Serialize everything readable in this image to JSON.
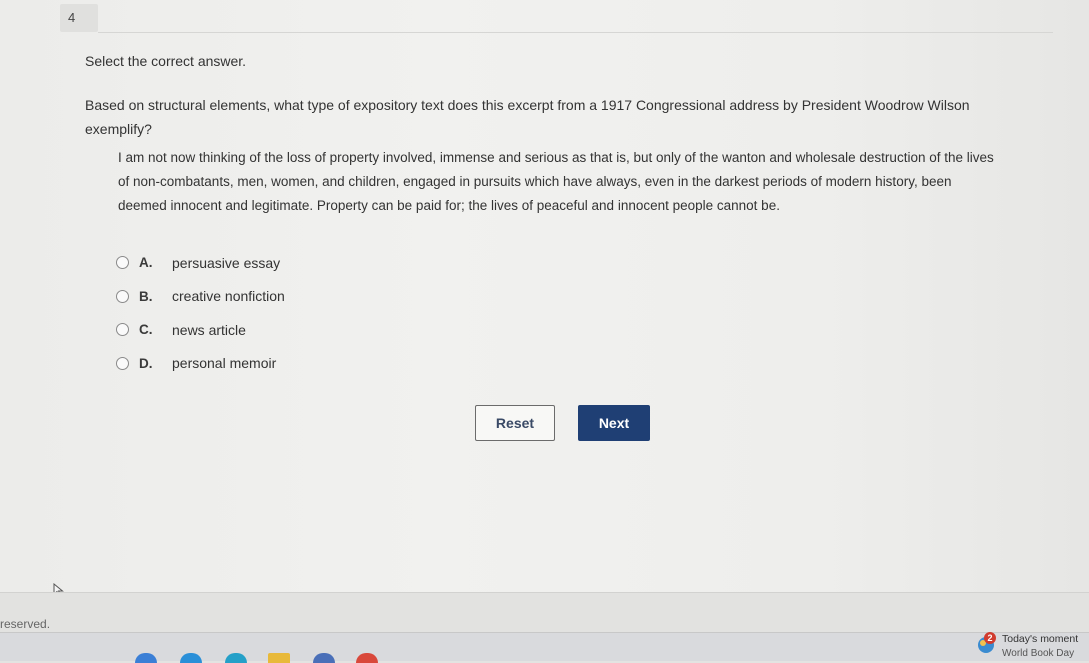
{
  "question": {
    "number": "4",
    "instruction": "Select the correct answer.",
    "prompt": "Based on structural elements, what type of expository text does this excerpt from a 1917 Congressional address by President Woodrow Wilson exemplify?",
    "excerpt_lines": [
      "I am not now thinking of the loss of property involved, immense and serious as that is, but only of the wanton and wholesale destruction of the lives",
      "of non-combatants, men, women, and children, engaged in pursuits which have always, even in the darkest periods of modern history, been",
      "deemed innocent and legitimate. Property can be paid for; the lives of peaceful and innocent people cannot be."
    ],
    "options": [
      {
        "letter": "A.",
        "text": "persuasive essay"
      },
      {
        "letter": "B.",
        "text": "creative nonfiction"
      },
      {
        "letter": "C.",
        "text": "news article"
      },
      {
        "letter": "D.",
        "text": "personal memoir"
      }
    ]
  },
  "buttons": {
    "reset_label": "Reset",
    "next_label": "Next"
  },
  "footer": {
    "text": "reserved."
  },
  "taskbar": {
    "widget_badge": "2",
    "widget_title": "Today's moment",
    "widget_subtitle": "World Book Day"
  },
  "colors": {
    "next_button": "#1f3f74",
    "reset_text": "#3a4a66",
    "badge": "#d13b2e"
  }
}
